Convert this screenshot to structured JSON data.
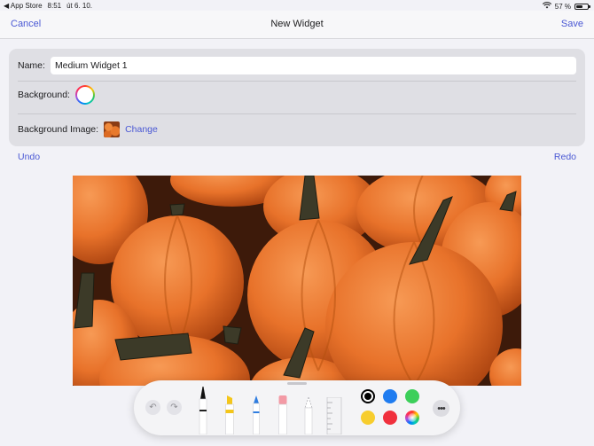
{
  "status_bar": {
    "back_app": "◀ App Store",
    "time": "8:51",
    "date": "út 6. 10.",
    "battery": "57 %",
    "battery_level": 0.57
  },
  "nav": {
    "cancel": "Cancel",
    "title": "New Widget",
    "save": "Save"
  },
  "form": {
    "name_label": "Name:",
    "name_value": "Medium Widget 1",
    "background_label": "Background:",
    "background_image_label": "Background Image:",
    "change_label": "Change"
  },
  "edit": {
    "undo": "Undo",
    "redo": "Redo"
  },
  "toolbar": {
    "tools": [
      "pen",
      "marker",
      "pencil",
      "eraser",
      "lasso",
      "ruler"
    ],
    "colors": [
      "#000000",
      "#1f7cf0",
      "#3ccf5a",
      "#f7cd2e",
      "#f0303d"
    ],
    "selected_color": "#000000"
  }
}
